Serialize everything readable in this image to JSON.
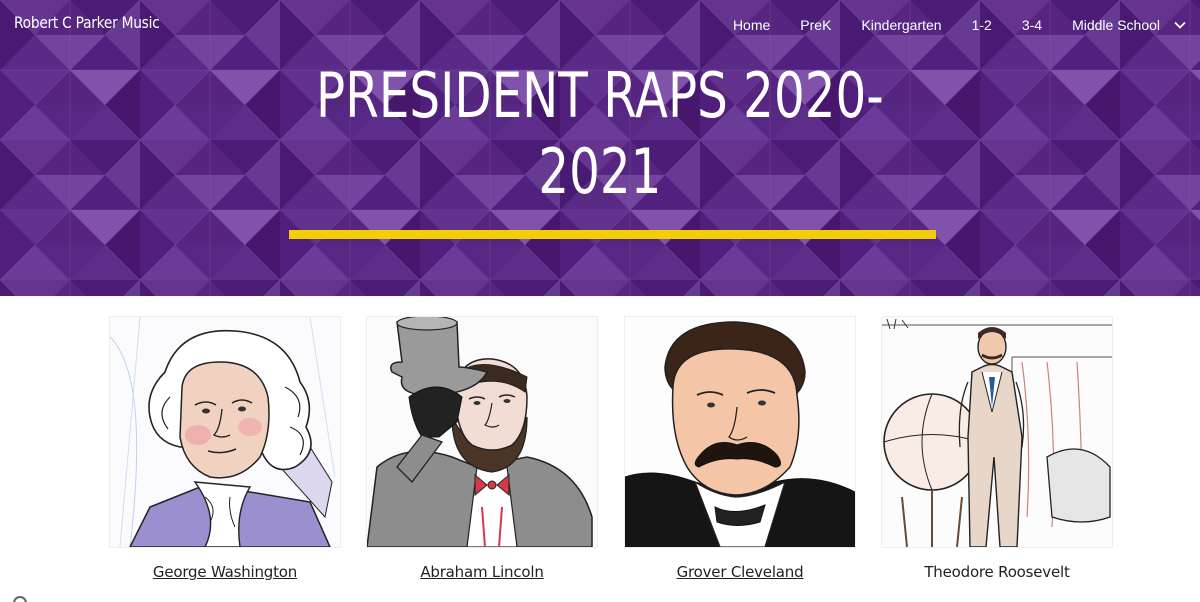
{
  "header": {
    "site_title": "Robert C Parker Music",
    "nav": [
      {
        "label": "Home"
      },
      {
        "label": "PreK"
      },
      {
        "label": "Kindergarten"
      },
      {
        "label": "1-2"
      },
      {
        "label": "3-4"
      },
      {
        "label": "Middle School",
        "has_dropdown": true,
        "icon": "chevron-down-icon"
      }
    ]
  },
  "hero": {
    "title_line1": "PRESIDENT RAPS 2020-",
    "title_line2": "2021",
    "underline_color": "#f3cd06",
    "background_color": "#5b2a86"
  },
  "presidents": [
    {
      "name": "George Washington",
      "linked": true
    },
    {
      "name": "Abraham Lincoln",
      "linked": true
    },
    {
      "name": "Grover Cleveland",
      "linked": true
    },
    {
      "name": "Theodore Roosevelt",
      "linked": false
    }
  ]
}
